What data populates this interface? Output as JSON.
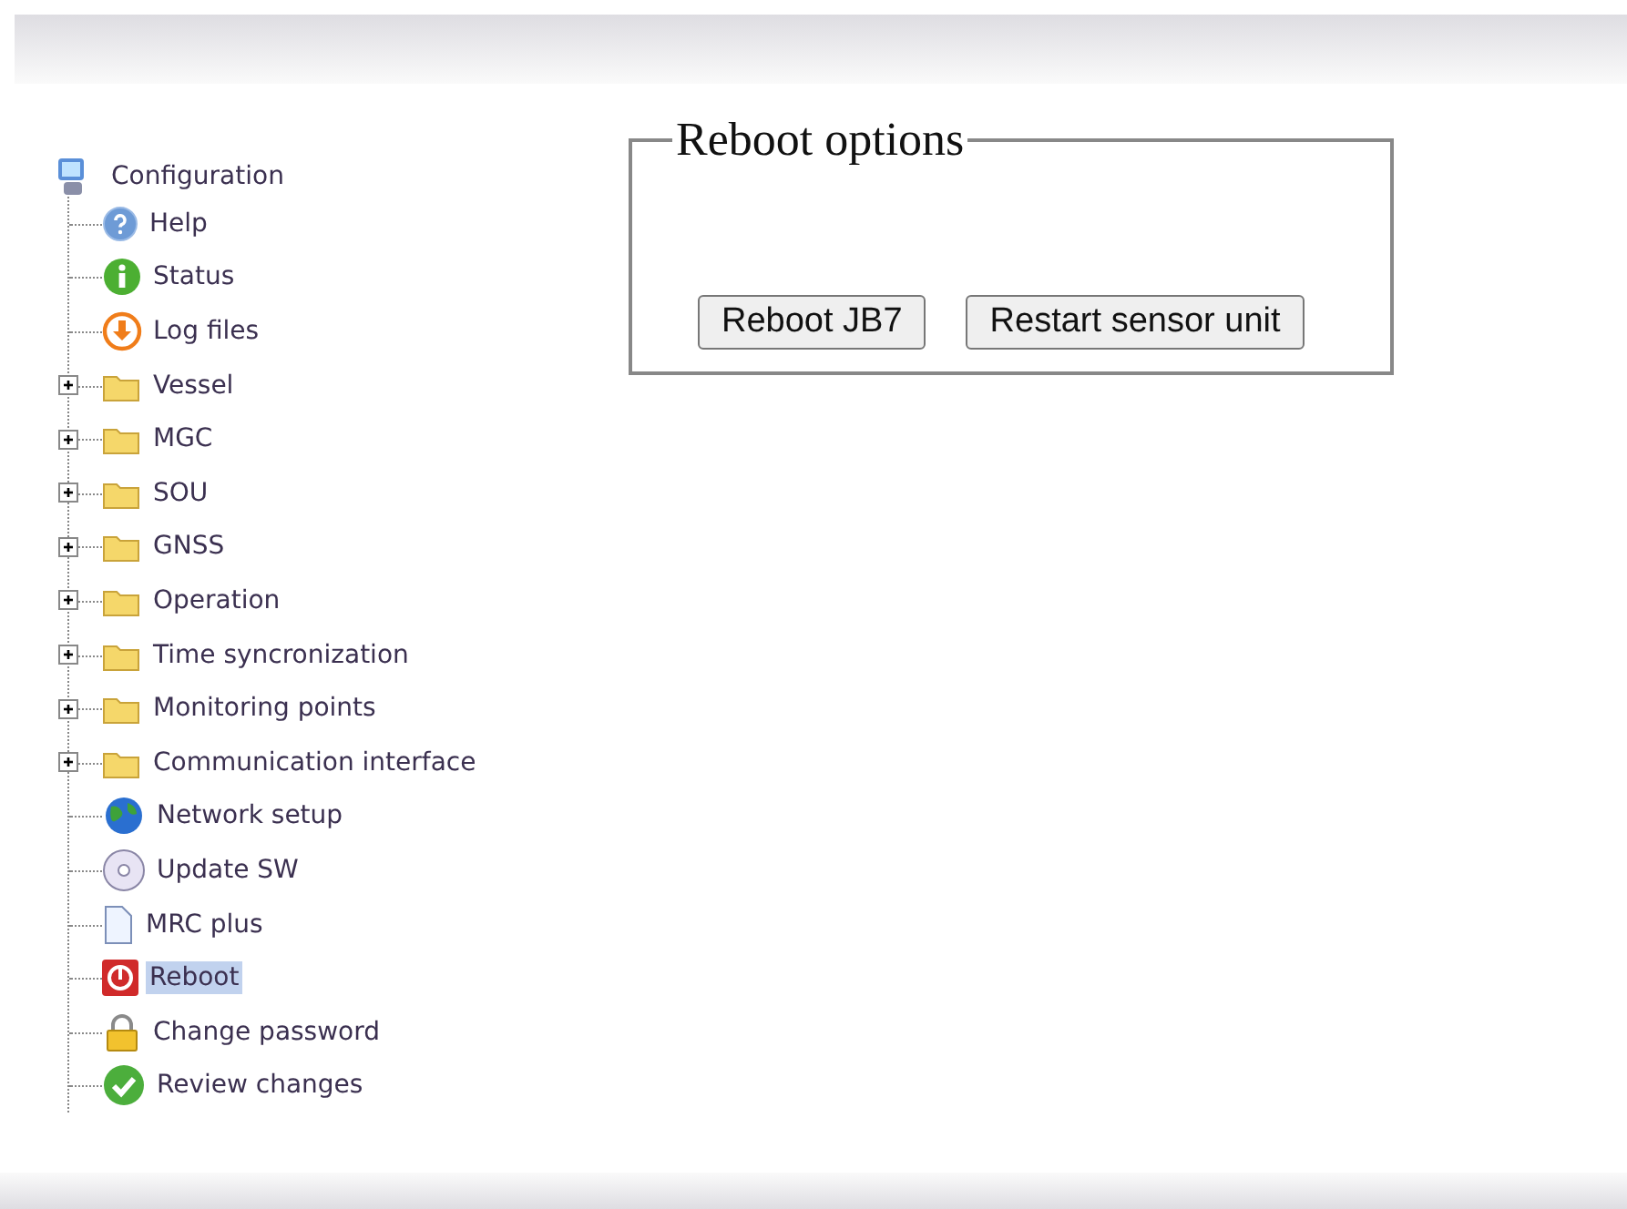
{
  "tree": {
    "label": "Configuration",
    "children": [
      {
        "label": "Help",
        "kind": "help",
        "selected": false
      },
      {
        "label": "Status",
        "kind": "info",
        "selected": false
      },
      {
        "label": "Log files",
        "kind": "download",
        "selected": false
      },
      {
        "label": "Vessel",
        "kind": "folder",
        "expanded": false,
        "selected": false
      },
      {
        "label": "MGC",
        "kind": "folder",
        "expanded": false,
        "selected": false
      },
      {
        "label": "SOU",
        "kind": "folder",
        "expanded": false,
        "selected": false
      },
      {
        "label": "GNSS",
        "kind": "folder",
        "expanded": false,
        "selected": false
      },
      {
        "label": "Operation",
        "kind": "folder",
        "expanded": false,
        "selected": false
      },
      {
        "label": "Time syncronization",
        "kind": "folder",
        "expanded": false,
        "selected": false
      },
      {
        "label": "Monitoring points",
        "kind": "folder",
        "expanded": false,
        "selected": false
      },
      {
        "label": "Communication interface",
        "kind": "folder",
        "expanded": false,
        "selected": false
      },
      {
        "label": "Network setup",
        "kind": "globe",
        "selected": false
      },
      {
        "label": "Update SW",
        "kind": "disc",
        "selected": false
      },
      {
        "label": "MRC plus",
        "kind": "document",
        "selected": false
      },
      {
        "label": "Reboot",
        "kind": "power",
        "selected": true
      },
      {
        "label": "Change password",
        "kind": "lock",
        "selected": false
      },
      {
        "label": "Review changes",
        "kind": "check",
        "selected": false
      }
    ]
  },
  "panel": {
    "legend": "Reboot options",
    "buttons": [
      "Reboot JB7",
      "Restart sensor unit"
    ]
  }
}
